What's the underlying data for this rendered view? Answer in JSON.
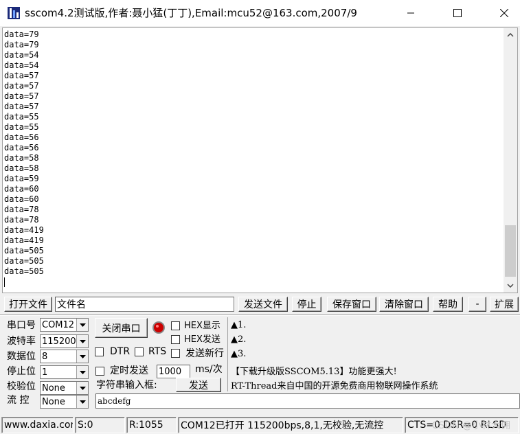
{
  "window": {
    "title": "sscom4.2测试版,作者:聂小猛(丁丁),Email:mcu52@163.com,2007/9"
  },
  "receive": {
    "lines": [
      "data=79",
      "data=79",
      "data=54",
      "data=54",
      "data=57",
      "data=57",
      "data=57",
      "data=57",
      "data=55",
      "data=55",
      "data=56",
      "data=56",
      "data=58",
      "data=58",
      "data=59",
      "data=60",
      "data=60",
      "data=78",
      "data=78",
      "data=419",
      "data=419",
      "data=505",
      "data=505",
      "data=505"
    ]
  },
  "toolbar": {
    "open_file": "打开文件",
    "filename": "文件名",
    "send_file": "发送文件",
    "stop": "停止",
    "save_window": "保存窗口",
    "clear_window": "清除窗口",
    "help": "帮助",
    "minus": "-",
    "expand": "扩展"
  },
  "serial": {
    "port_label": "串口号",
    "port_value": "COM12",
    "baud_label": "波特率",
    "baud_value": "115200",
    "databits_label": "数据位",
    "databits_value": "8",
    "stopbits_label": "停止位",
    "stopbits_value": "1",
    "parity_label": "校验位",
    "parity_value": "None",
    "flow_label": "流 控",
    "flow_value": "None"
  },
  "controls": {
    "close_port": "关闭串口",
    "hex_display": "HEX显示",
    "hex_send": "HEX发送",
    "send_newline": "发送新行",
    "dtr": "DTR",
    "rts": "RTS",
    "timed_send": "定时发送",
    "interval": "1000",
    "interval_unit": "ms/次",
    "input_label": "字符串输入框:",
    "send": "发送",
    "input_value": "abcdefg"
  },
  "info": {
    "line1": "▲1.",
    "line2": "▲2.",
    "line3": "▲3.",
    "line4": "【下载升级版SSCOM5.13】功能更强大!",
    "line5": "RT-Thread来自中国的开源免费商用物联网操作系统"
  },
  "status": {
    "site": "www.daxia.com",
    "sent": "S:0",
    "received": "R:1055",
    "port_state": "COM12已打开  115200bps,8,1,无校验,无流控",
    "lines": "CTS=0 DSR=0 RLSD",
    "watermark": "CSDN @小林大佣"
  },
  "colors": {
    "led": "#cc0000",
    "accent": "#0078d7"
  },
  "icons": {
    "app": "sscom-app-icon",
    "minimize": "minimize-icon",
    "maximize": "maximize-icon",
    "close": "close-icon"
  }
}
